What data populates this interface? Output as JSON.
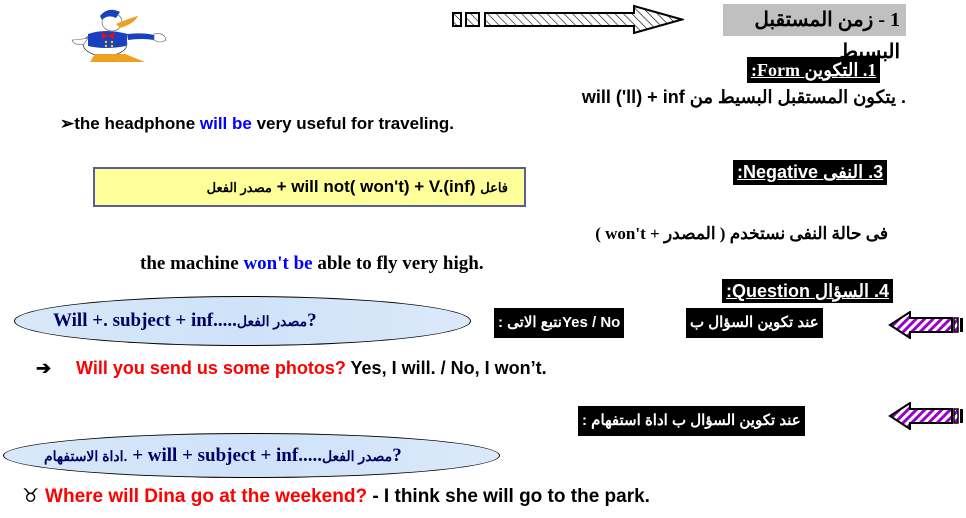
{
  "header": {
    "title": "1 - زمن المستقبل البسيط",
    "arrow_icon": "right-arrow-hatched",
    "illustration": "donald-duck"
  },
  "form_section": {
    "heading_number": "1.",
    "heading_ar": "التكوين",
    "heading_en": "Form",
    "heading_colon": ":",
    "rule_ar": ". يتكون المستقبل البسيط من",
    "rule_en": "will ('ll) + inf",
    "example": {
      "bullet": "➢",
      "before": "the headphone ",
      "highlight": "will be",
      "after": " very  useful for traveling."
    }
  },
  "negative_section": {
    "heading_number": "3.",
    "heading_ar": "النفى",
    "heading_en": "Negative",
    "heading_colon": ":",
    "formula": {
      "subject_ar": "فاعل",
      "middle": " + will not( won't) +  V.(inf) ",
      "verb_ar": "مصدر الفعل"
    },
    "rule_ar": "فى حالة النفى نستخدم ( المصدر + won't )",
    "example": {
      "before": "the machine ",
      "highlight": "won't be",
      "after": " able to fly very high."
    }
  },
  "question_section": {
    "heading_number": "4.",
    "heading_ar": "السؤال",
    "heading_en": "Question",
    "heading_colon": ":",
    "yesno_label_right": "عند تكوين السؤال ب",
    "yesno_label_left_en": "Yes / No",
    "yesno_label_left_ar": "نتبع الاتى :",
    "yesno_formula": {
      "en": "Will +. subject + inf.....",
      "ar": "مصدر الفعل",
      "end": "?"
    },
    "yesno_example": {
      "bullet": "➔",
      "question": "Will you send us some photos?",
      "answer": " Yes, I will. / No, I won’t."
    },
    "wh_label": "عند تكوين السؤال ب  اداة استفهام :",
    "wh_formula": {
      "ar_start": "اداة الاستفهام.",
      "en": " + will + subject + inf.....",
      "ar": "مصدر الفعل",
      "end": "?"
    },
    "wh_example": {
      "bullet": "♉",
      "question": "Where will Dina go at the weekend?",
      "answer": " - I think she will go to the park."
    }
  },
  "colors": {
    "highlight_blue": "#0000ff",
    "question_red": "#ff0000",
    "formula_box_yellow": "#ffff99",
    "ellipse_blue": "#d8e8f8",
    "ellipse_text": "#000066",
    "arrow_purple": "#9900cc",
    "title_gray": "#c0c0c0"
  }
}
